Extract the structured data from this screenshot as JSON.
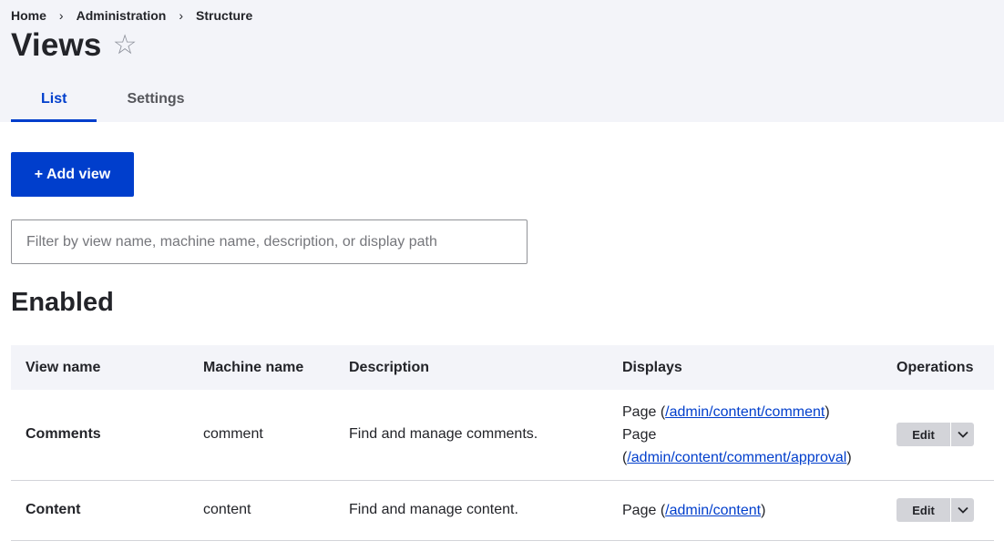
{
  "breadcrumb": {
    "items": [
      "Home",
      "Administration",
      "Structure"
    ],
    "separator": "›"
  },
  "page": {
    "title": "Views",
    "star": "☆"
  },
  "tabs": [
    {
      "label": "List",
      "active": true
    },
    {
      "label": "Settings",
      "active": false
    }
  ],
  "actions": {
    "add_view_label": "+ Add view"
  },
  "filter": {
    "placeholder": "Filter by view name, machine name, description, or display path",
    "value": ""
  },
  "section": {
    "title": "Enabled"
  },
  "table": {
    "headers": [
      "View name",
      "Machine name",
      "Description",
      "Displays",
      "Operations"
    ],
    "rows": [
      {
        "name": "Comments",
        "machine": "comment",
        "description": "Find and manage comments.",
        "displays": [
          {
            "prefix": "Page (",
            "link": "/admin/content/comment",
            "suffix": ")"
          },
          {
            "prefix": "Page",
            "link": "/admin/content/comment/approval",
            "suffix": ")"
          }
        ],
        "edit_label": "Edit"
      },
      {
        "name": "Content",
        "machine": "content",
        "description": "Find and manage content.",
        "displays": [
          {
            "prefix": "Page (",
            "link": "/admin/content",
            "suffix": ")"
          }
        ],
        "edit_label": "Edit"
      }
    ]
  },
  "colors": {
    "accent": "#003ecc",
    "header_bg": "#f3f4f9",
    "button_gray": "#d3d4d9",
    "text": "#232429"
  },
  "icons": {
    "favorite": "star-icon",
    "dropdown": "chevron-down-icon"
  }
}
